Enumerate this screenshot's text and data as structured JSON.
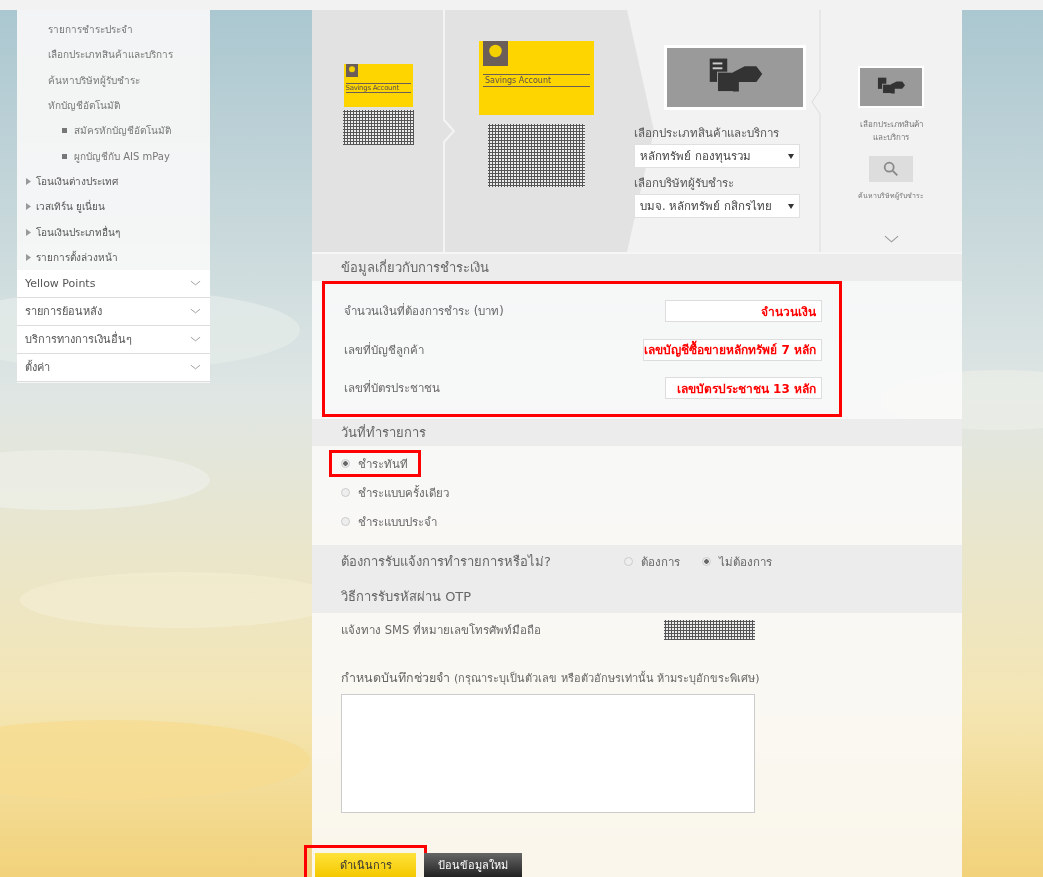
{
  "sidebar": {
    "sub_items": [
      {
        "label": "รายการชำระประจำ",
        "kind": "link"
      },
      {
        "label": "เลือกประเภทสินค้าและบริการ",
        "kind": "link"
      },
      {
        "label": "ค้นหาบริษัทผู้รับชำระ",
        "kind": "link"
      },
      {
        "label": "หักบัญชีอัตโนมัติ",
        "kind": "link"
      },
      {
        "label": "สมัครหักบัญชีอัตโนมัติ",
        "kind": "bullet"
      },
      {
        "label": "ผูกบัญชีกับ AIS mPay",
        "kind": "bullet"
      },
      {
        "label": "โอนเงินต่างประเทศ",
        "kind": "group"
      },
      {
        "label": "เวสเทิร์น ยูเนี่ยน",
        "kind": "group"
      },
      {
        "label": "โอนเงินประเภทอื่นๆ",
        "kind": "group"
      },
      {
        "label": "รายการตั้งล่วงหน้า",
        "kind": "group"
      }
    ],
    "sections": [
      {
        "label": "Yellow Points",
        "expanded": false
      },
      {
        "label": "รายการย้อนหลัง",
        "expanded": false
      },
      {
        "label": "บริการทางการเงินอื่นๆ",
        "expanded": false
      },
      {
        "label": "ตั้งค่า",
        "expanded": false
      }
    ]
  },
  "carousel": {
    "cards": [
      {
        "label": "Savings Account",
        "selected": false
      },
      {
        "label": "Savings Account",
        "selected": true
      }
    ],
    "product_prompt": "เลือกประเภทสินค้าและบริการ",
    "product_value": "หลักทรัพย์ กองทุนรวม",
    "biller_prompt": "เลือกบริษัทผู้รับชำระ",
    "biller_value": "บมจ. หลักทรัพย์ กสิกรไทย",
    "side_options": [
      {
        "label": "เลือกประเภทสินค้าและบริการ",
        "kind": "product"
      },
      {
        "label": "ค้นหาบริษัทผู้รับชำระ",
        "kind": "search"
      }
    ]
  },
  "payment_info": {
    "title": "ข้อมูลเกี่ยวกับการชำระเงิน",
    "highlighted": true,
    "fields": [
      {
        "label": "จำนวนเงินที่ต้องการชำระ (บาท)",
        "value": "จำนวนเงิน"
      },
      {
        "label": "เลขที่บัญชีลูกค้า",
        "value": "เลขบัญชีซื้อขายหลักทรัพย์ 7 หลัก"
      },
      {
        "label": "เลขที่บัตรประชาชน",
        "value": "เลขบัตรประชาชน 13 หลัก"
      }
    ]
  },
  "transaction_date": {
    "title": "วันที่ทำรายการ",
    "options": [
      {
        "label": "ชำระทันที",
        "selected": true,
        "highlighted": true
      },
      {
        "label": "ชำระแบบครั้งเดียว",
        "selected": false,
        "highlighted": false
      },
      {
        "label": "ชำระแบบประจำ",
        "selected": false,
        "highlighted": false
      }
    ]
  },
  "notification": {
    "question": "ต้องการรับแจ้งการทำรายการหรือไม่?",
    "options": [
      {
        "label": "ต้องการ",
        "selected": false
      },
      {
        "label": "ไม่ต้องการ",
        "selected": true
      }
    ],
    "otp_title": "วิธีการรับรหัสผ่าน OTP",
    "sms_label": "แจ้งทาง SMS ที่หมายเลขโทรศัพท์มือถือ"
  },
  "memo": {
    "label": "กำหนดบันทึกช่วยจำ",
    "hint": "(กรุณาระบุเป็นตัวเลข หรือตัวอักษรเท่านั้น ห้ามระบุอักขระพิเศษ)"
  },
  "buttons": [
    {
      "label": "ดำเนินการ",
      "kind": "primary",
      "highlighted": true
    },
    {
      "label": "ป้อนข้อมูลใหม่",
      "kind": "secondary",
      "highlighted": false
    }
  ]
}
